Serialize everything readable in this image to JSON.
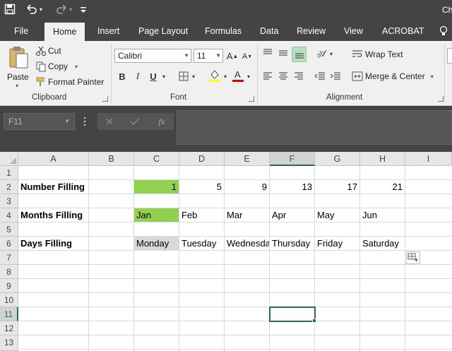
{
  "title": {
    "text": "Ch",
    "save_icon": "save-icon",
    "undo_icon": "undo-icon",
    "redo_icon": "redo-icon",
    "customize_icon": "customize-qat-icon"
  },
  "tabs": [
    "File",
    "Home",
    "Insert",
    "Page Layout",
    "Formulas",
    "Data",
    "Review",
    "View",
    "ACROBAT"
  ],
  "active_tab": "Home",
  "ribbon": {
    "clipboard": {
      "paste": "Paste",
      "cut": "Cut",
      "copy": "Copy",
      "format_painter": "Format Painter",
      "label": "Clipboard"
    },
    "font": {
      "name": "Calibri",
      "size": "11",
      "bold": "B",
      "italic": "I",
      "underline": "U",
      "label": "Font",
      "font_color": "#e00000",
      "highlight_color": "#ffff00"
    },
    "alignment": {
      "wrap_text": "Wrap Text",
      "merge_center": "Merge & Center",
      "label": "Alignment"
    }
  },
  "formula_bar": {
    "name_box": "F11",
    "fx": "fx",
    "value": ""
  },
  "columns": [
    "A",
    "B",
    "C",
    "D",
    "E",
    "F",
    "G",
    "H",
    "I"
  ],
  "rows": [
    "1",
    "2",
    "3",
    "4",
    "5",
    "6",
    "7",
    "8",
    "9",
    "10",
    "11",
    "12",
    "13"
  ],
  "selected_cell": "F11",
  "sheet": {
    "row2": {
      "label": "Number Filling",
      "values": [
        "1",
        "5",
        "9",
        "13",
        "17",
        "21"
      ]
    },
    "row4": {
      "label": "Months Filling",
      "values": [
        "Jan",
        "Feb",
        "Mar",
        "Apr",
        "May",
        "Jun"
      ]
    },
    "row6": {
      "label": "Days Filling",
      "values": [
        "Monday",
        "Tuesday",
        "Wednesday",
        "Thursday",
        "Friday",
        "Saturday"
      ]
    }
  },
  "colors": {
    "accent": "#217346",
    "title_bar": "#444444",
    "fill_green": "#92d050",
    "fill_gray": "#d9d9d9"
  }
}
